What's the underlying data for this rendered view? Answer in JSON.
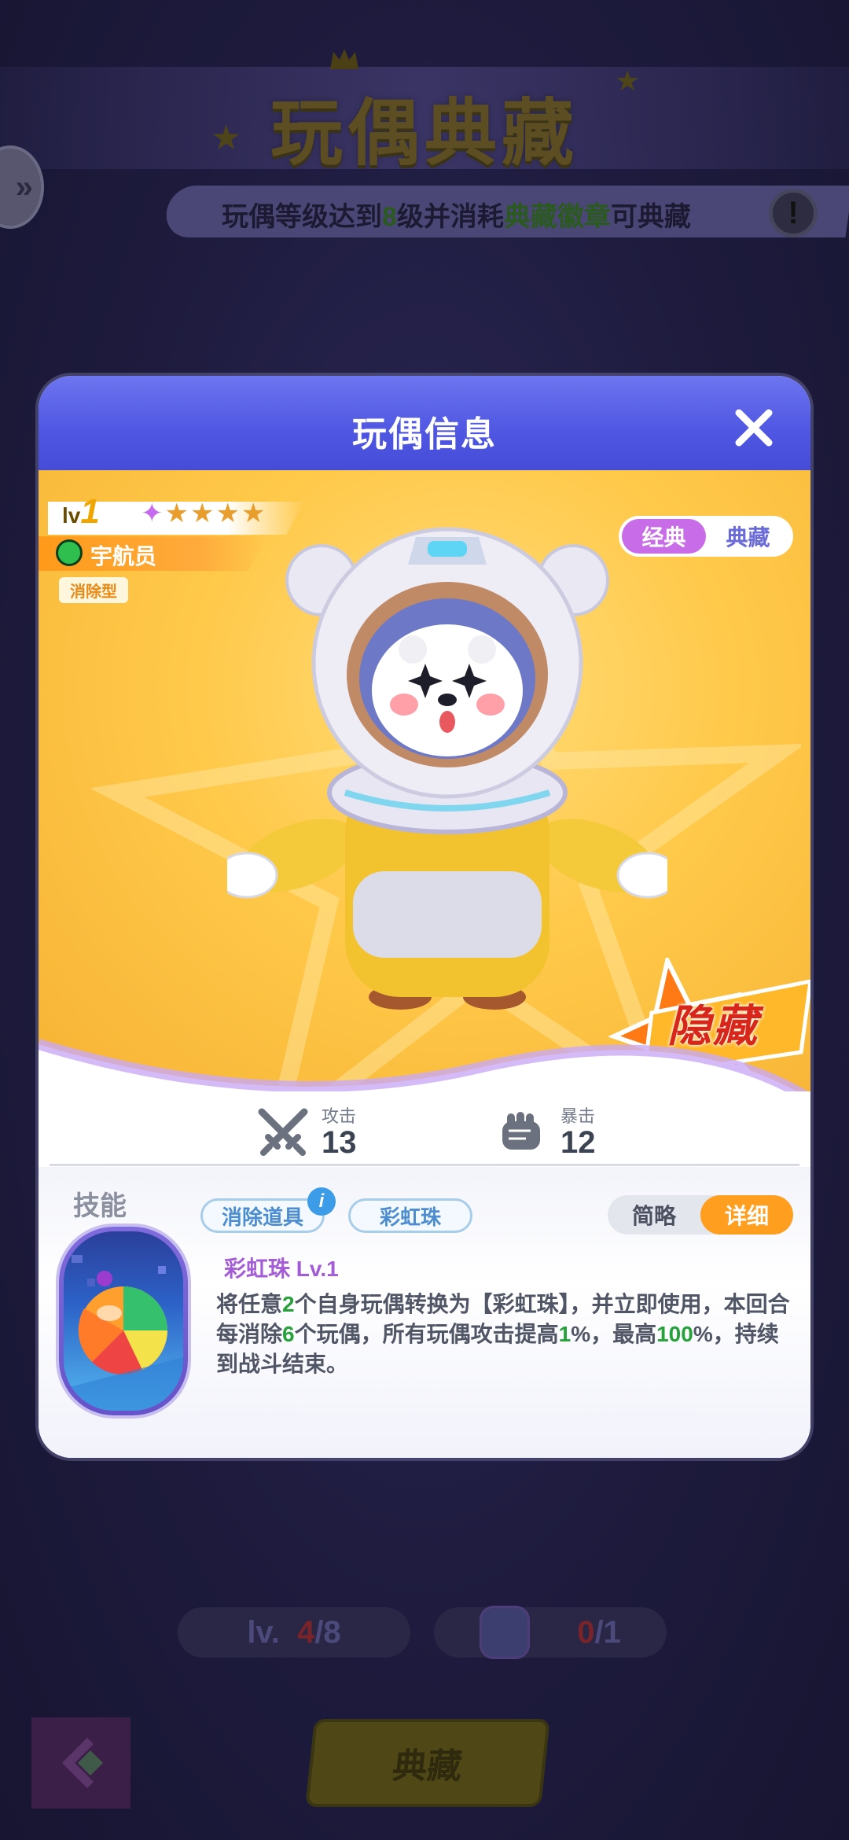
{
  "background": {
    "title": "玩偶典藏",
    "notice": {
      "part1": "玩偶等级达到",
      "level": "8",
      "part2": "级并消耗",
      "badge": "典藏徽章",
      "part3": "可典藏"
    },
    "info_symbol": "!",
    "level_pill": {
      "prefix": "lv.",
      "current": "4",
      "sep_max": "/8"
    },
    "count_pill": {
      "current": "0",
      "sep_max": "/1"
    },
    "collect_button": "典藏"
  },
  "modal": {
    "title": "玩偶信息",
    "lv_prefix": "lv",
    "level": "1",
    "stars": 5,
    "name": "宇航员",
    "type": "消除型",
    "skin_toggle": {
      "options": [
        "经典",
        "典藏"
      ],
      "active": "经典"
    },
    "rarity_badge": "隐藏",
    "stats": {
      "attack": {
        "label": "攻击",
        "value": "13"
      },
      "crit": {
        "label": "暴击",
        "value": "12"
      }
    },
    "skill": {
      "section_label": "技能",
      "tags": [
        "消除道具",
        "彩虹珠"
      ],
      "info_symbol": "i",
      "mode_toggle": {
        "options": [
          "简略",
          "详细"
        ],
        "active": "详细"
      },
      "name": "彩虹珠 Lv.1",
      "desc": {
        "t1": "将任意",
        "n1": "2",
        "t2": "个自身玩偶转换为【彩虹珠】，并立即使用，本回合每消除",
        "n2": "6",
        "t3": "个玩偶，所有玩偶攻击提高",
        "n3": "1",
        "t4": "%，最高",
        "n4": "100",
        "t5": "%，持续到战斗结束。"
      }
    }
  },
  "colors": {
    "header_blue": "#4f56e2",
    "showcase_yellow": "#ffc94a",
    "accent_orange": "#ff9e1f",
    "skill_purple": "#a35cd6",
    "highlight_green": "#27a13b"
  }
}
